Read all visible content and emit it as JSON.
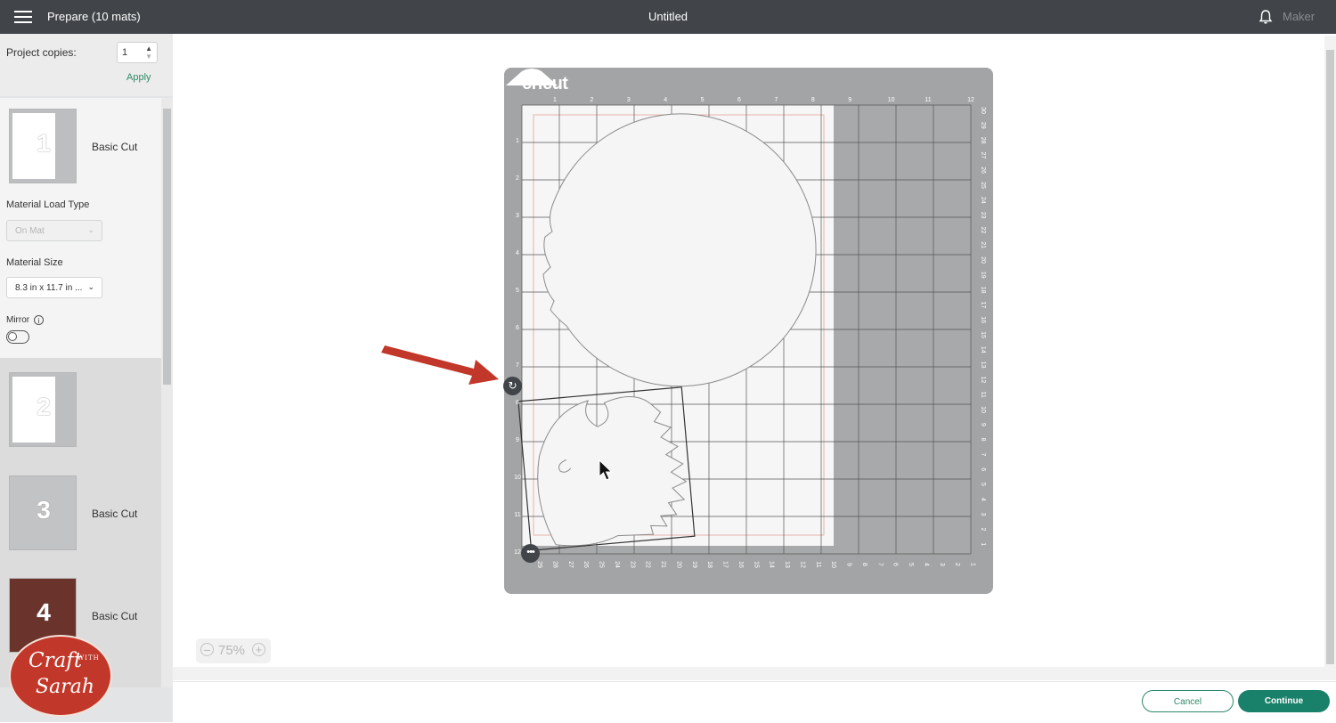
{
  "header": {
    "menu_icon": "hamburger-icon",
    "title": "Prepare (10 mats)",
    "doc_title": "Untitled",
    "bell_icon": "bell-icon",
    "machine": "Maker"
  },
  "sidebar": {
    "copies_label": "Project copies:",
    "copies_value": "1",
    "apply_label": "Apply",
    "mats": [
      {
        "number": "1",
        "label": "Basic Cut",
        "selected": true
      },
      {
        "number": "2",
        "label": ""
      },
      {
        "number": "3",
        "label": "Basic Cut"
      },
      {
        "number": "4",
        "label": "Basic Cut"
      }
    ],
    "load_type_label": "Material Load Type",
    "load_type_value": "On Mat",
    "size_label": "Material Size",
    "size_value": "8.3 in x 11.7 in ...",
    "mirror_label": "Mirror",
    "mirror_on": false
  },
  "mat": {
    "brand": "cricut",
    "top_ruler": [
      "1",
      "2",
      "3",
      "4",
      "5",
      "6",
      "7",
      "8",
      "9",
      "10",
      "11",
      "12"
    ],
    "left_ruler": [
      "1",
      "2",
      "3",
      "4",
      "5",
      "6",
      "7",
      "8",
      "9",
      "10",
      "11",
      "12"
    ],
    "right_ruler": [
      "30",
      "29",
      "28",
      "27",
      "26",
      "25",
      "24",
      "23",
      "22",
      "21",
      "20",
      "19",
      "18",
      "17",
      "16",
      "15",
      "14",
      "13",
      "12",
      "11",
      "10",
      "9",
      "8",
      "7",
      "6",
      "5",
      "4",
      "3",
      "2",
      "1"
    ],
    "bottom_ruler": [
      "29",
      "28",
      "27",
      "26",
      "25",
      "24",
      "23",
      "22",
      "21",
      "20",
      "19",
      "18",
      "17",
      "16",
      "15",
      "14",
      "13",
      "12",
      "11",
      "10",
      "9",
      "8",
      "7",
      "6",
      "5",
      "4",
      "3",
      "2",
      "1"
    ]
  },
  "zoom": {
    "value": "75%"
  },
  "footer": {
    "cancel_label": "Cancel",
    "continue_label": "Continue"
  },
  "watermark": {
    "line1": "Craft",
    "with": "WITH",
    "line2": "Sarah"
  },
  "colors": {
    "topbar": "#414549",
    "accent_green": "#19806a",
    "arrow_red": "#c1382a",
    "mat_grey": "#a3a4a5"
  }
}
